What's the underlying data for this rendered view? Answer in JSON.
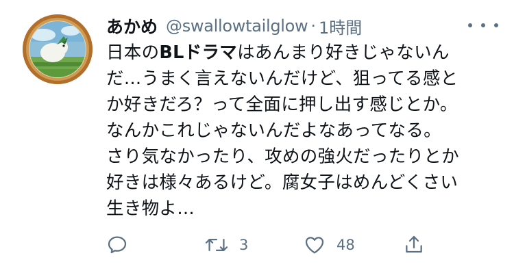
{
  "tweet": {
    "display_name": "あかめ",
    "handle": "@swallowtailglow",
    "separator": "·",
    "time": "1時間",
    "body": {
      "line1": {
        "pre": "日本の",
        "bold": "BLドラマ",
        "post": "はあんまり好きじゃないん"
      },
      "line2": "だ…うまく言えないんだけど、狙ってる感と",
      "line3": "か好きだろ？って全面に押し出す感じとか。",
      "line4": "なんかこれじゃないんだよなあってなる。",
      "line5": "さり気なかったり、攻めの強火だったりとか",
      "line6": "好きは様々あるけど。腐女子はめんどくさい",
      "line7": "生き物よ…"
    },
    "actions": {
      "reply": {
        "icon": "reply-icon"
      },
      "retweet": {
        "icon": "retweet-icon",
        "count": "3"
      },
      "like": {
        "icon": "heart-icon",
        "count": "48"
      },
      "share": {
        "icon": "share-icon"
      }
    }
  },
  "colors": {
    "text": "#0f1419",
    "secondary": "#5b7083",
    "avatar_border": "#b5742f"
  }
}
